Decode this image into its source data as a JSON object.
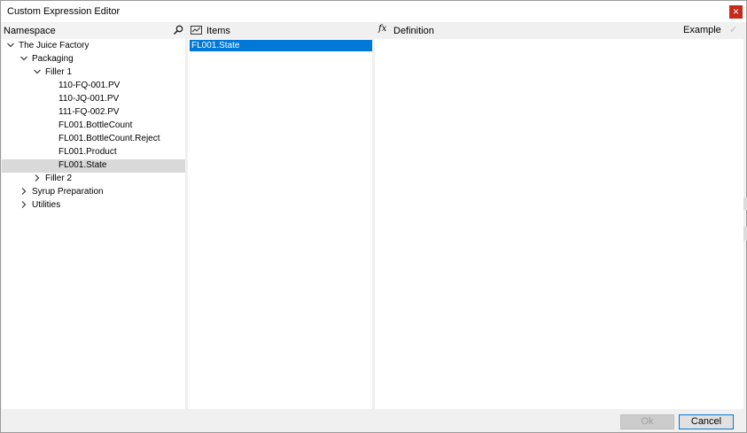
{
  "window": {
    "title": "Custom Expression Editor",
    "close_glyph": "×"
  },
  "namespace": {
    "header": "Namespace",
    "tree": [
      {
        "label": "The Juice Factory",
        "depth": 0,
        "expander": "expanded"
      },
      {
        "label": "Packaging",
        "depth": 1,
        "expander": "expanded"
      },
      {
        "label": "Filler 1",
        "depth": 2,
        "expander": "expanded"
      },
      {
        "label": "110-FQ-001.PV",
        "depth": 3,
        "expander": "none"
      },
      {
        "label": "110-JQ-001.PV",
        "depth": 3,
        "expander": "none"
      },
      {
        "label": "111-FQ-002.PV",
        "depth": 3,
        "expander": "none"
      },
      {
        "label": "FL001.BottleCount",
        "depth": 3,
        "expander": "none"
      },
      {
        "label": "FL001.BottleCount.Reject",
        "depth": 3,
        "expander": "none"
      },
      {
        "label": "FL001.Product",
        "depth": 3,
        "expander": "none"
      },
      {
        "label": "FL001.State",
        "depth": 3,
        "expander": "none",
        "selected": true
      },
      {
        "label": "Filler 2",
        "depth": 2,
        "expander": "collapsed"
      },
      {
        "label": "Syrup Preparation",
        "depth": 1,
        "expander": "collapsed"
      },
      {
        "label": "Utilities",
        "depth": 1,
        "expander": "collapsed"
      }
    ]
  },
  "items": {
    "header": "Items",
    "list": [
      "FL001.State"
    ]
  },
  "definition": {
    "fx_glyph": "fx",
    "header": "Definition",
    "example_label": "Example",
    "check_glyph": "✓"
  },
  "footer": {
    "ok_label": "Ok",
    "cancel_label": "Cancel"
  },
  "colors": {
    "selection_blue": "#0078d7",
    "close_red": "#c42b1c",
    "tree_selected": "#d9d9d9"
  }
}
